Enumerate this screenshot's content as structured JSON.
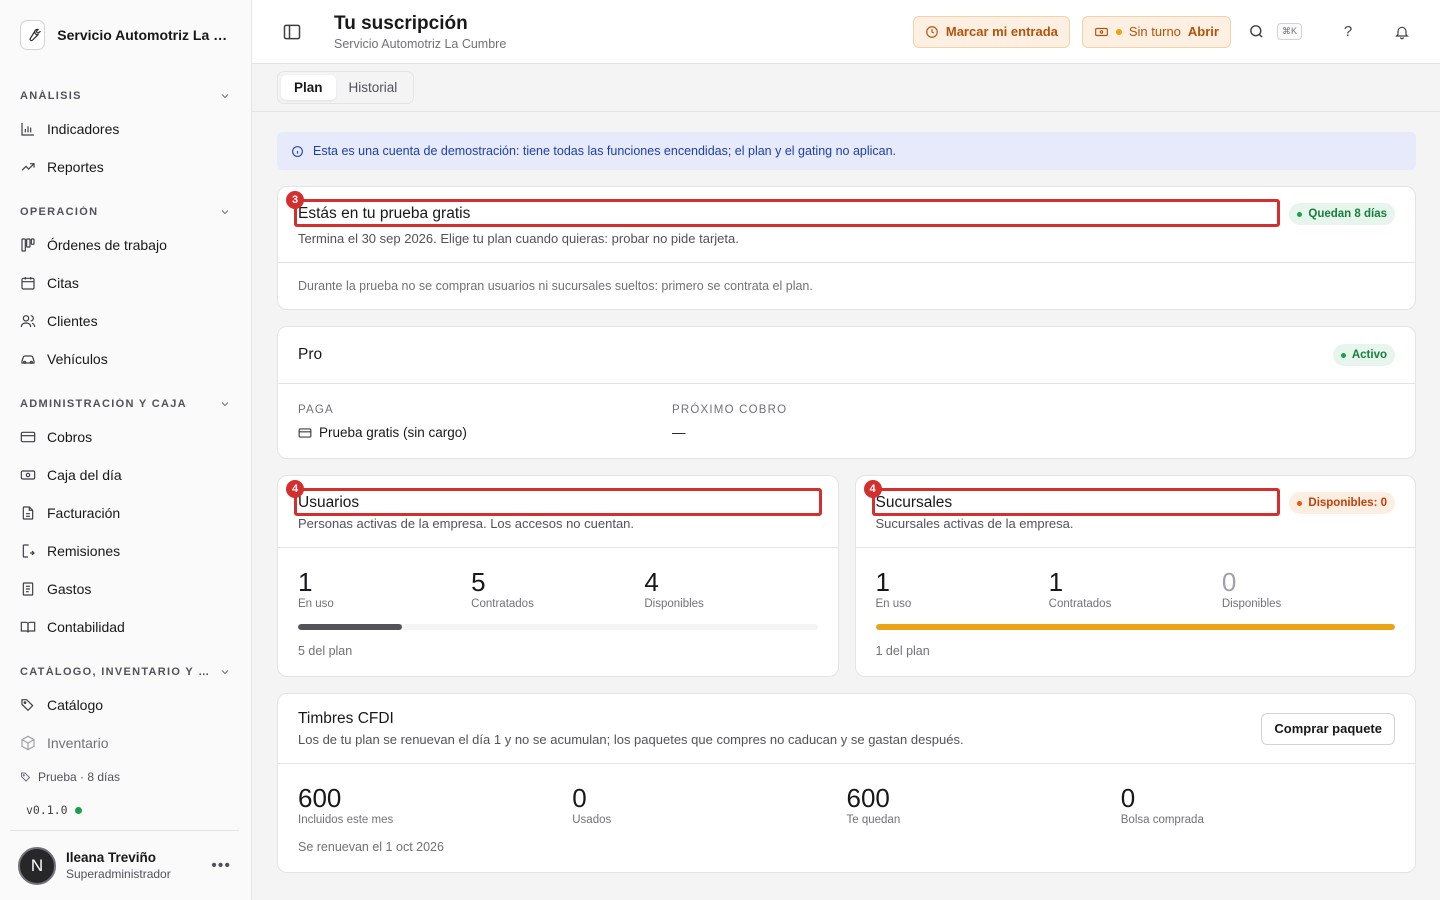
{
  "sidebar": {
    "brand": "Servicio Automotriz La Cumbre",
    "sections": [
      {
        "label": "ANÁLISIS",
        "items": [
          "Indicadores",
          "Reportes"
        ]
      },
      {
        "label": "OPERACIÓN",
        "items": [
          "Órdenes de trabajo",
          "Citas",
          "Clientes",
          "Vehículos"
        ]
      },
      {
        "label": "ADMINISTRACIÓN Y CAJA",
        "items": [
          "Cobros",
          "Caja del día",
          "Facturación",
          "Remisiones",
          "Gastos",
          "Contabilidad"
        ]
      },
      {
        "label": "CATÁLOGO, INVENTARIO Y COMPRAS",
        "items": [
          "Catálogo",
          "Inventario"
        ]
      }
    ],
    "trial_tag": "Prueba · 8 días",
    "version": "v0.1.0",
    "user": {
      "initial": "N",
      "name": "Ileana Treviño",
      "role": "Superadministrador"
    }
  },
  "topbar": {
    "title": "Tu suscripción",
    "subtitle": "Servicio Automotriz La Cumbre",
    "check_in": "Marcar mi entrada",
    "shift_status": "Sin turno",
    "shift_open": "Abrir",
    "shortcut": "⌘K",
    "help": "?"
  },
  "tabs": [
    "Plan",
    "Historial"
  ],
  "demo_banner": "Esta es una cuenta de demostración: tiene todas las funciones encendidas; el plan y el gating no aplican.",
  "trial": {
    "annotation": "3",
    "title": "Estás en tu prueba gratis",
    "badge": "Quedan 8 días",
    "desc": "Termina el 30 sep 2026. Elige tu plan cuando quieras: probar no pide tarjeta.",
    "note": "Durante la prueba no se compran usuarios ni sucursales sueltos: primero se contrata el plan."
  },
  "plan": {
    "name": "Pro",
    "badge": "Activo",
    "pay_label": "PAGA",
    "pay_value": "Prueba gratis (sin cargo)",
    "next_label": "PRÓXIMO COBRO",
    "next_value": "—"
  },
  "users": {
    "annotation": "4",
    "title": "Usuarios",
    "desc": "Personas activas de la empresa. Los accesos no cuentan.",
    "in_use": "1",
    "in_use_label": "En uso",
    "contracted": "5",
    "contracted_label": "Contratados",
    "available": "4",
    "available_label": "Disponibles",
    "progress": 0.2,
    "bar_color": "#52525b",
    "note": "5 del plan"
  },
  "branches": {
    "annotation": "4",
    "title": "Sucursales",
    "badge": "Disponibles: 0",
    "desc": "Sucursales activas de la empresa.",
    "in_use": "1",
    "in_use_label": "En uso",
    "contracted": "1",
    "contracted_label": "Contratados",
    "available": "0",
    "available_label": "Disponibles",
    "progress": 1.0,
    "bar_color": "#eaa316",
    "note": "1 del plan"
  },
  "stamps": {
    "title": "Timbres CFDI",
    "desc": "Los de tu plan se renuevan el día 1 y no se acumulan; los paquetes que compres no caducan y se gastan después.",
    "buy_button": "Comprar paquete",
    "included": "600",
    "included_label": "Incluidos este mes",
    "used": "0",
    "used_label": "Usados",
    "left": "600",
    "left_label": "Te quedan",
    "bag": "0",
    "bag_label": "Bolsa comprada",
    "renew_note": "Se renuevan el 1 oct 2026"
  }
}
